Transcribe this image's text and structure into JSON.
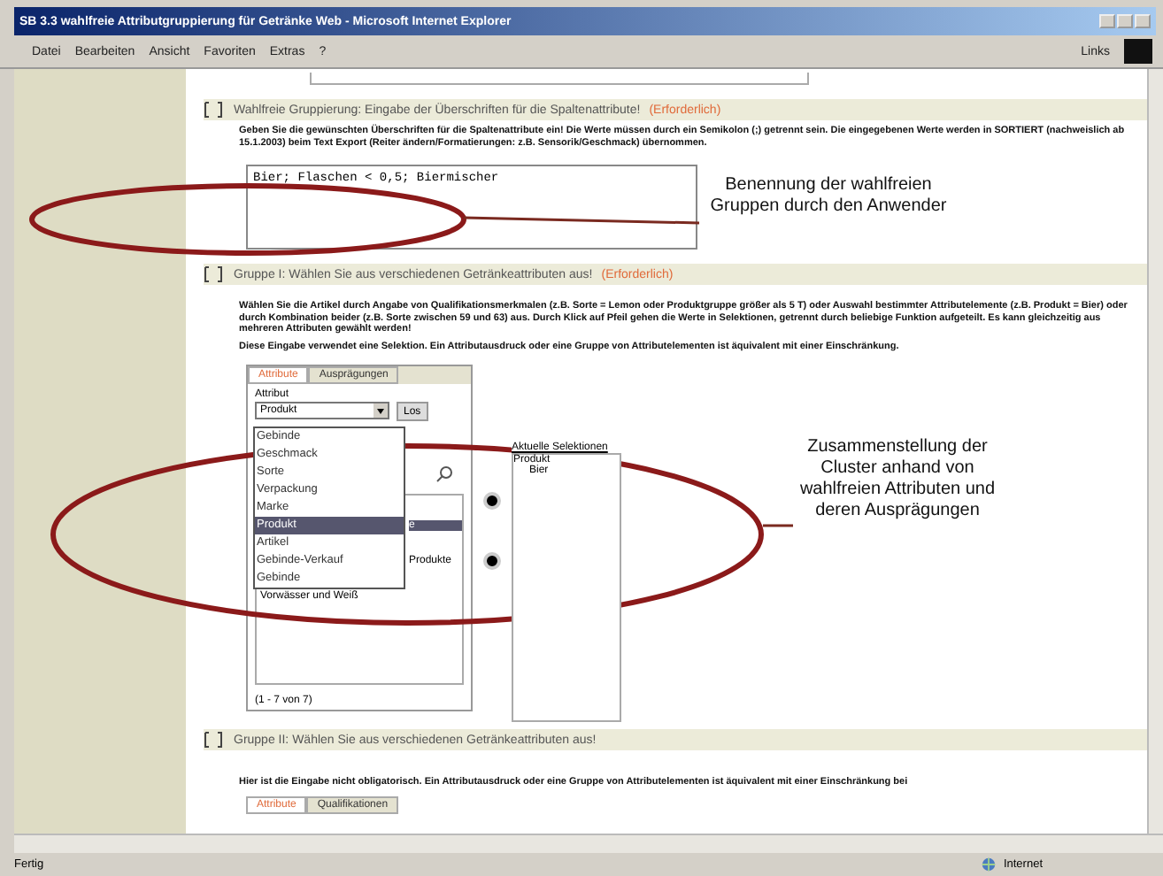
{
  "window": {
    "title": "SB 3.3 wahlfreie Attributgruppierung für Getränke Web - Microsoft Internet Explorer"
  },
  "menu": [
    "Datei",
    "Bearbeiten",
    "Ansicht",
    "Favoriten",
    "Extras",
    "?"
  ],
  "links_label": "Links",
  "sections": [
    {
      "kind": "names",
      "title": "Wahlfreie Gruppierung: Eingabe der Überschriften für die Spaltenattribute!",
      "required": "(Erforderlich)",
      "text": "Geben Sie die gewünschten Überschriften für die Spaltenattribute ein! Die Werte müssen durch ein Semikolon (;) getrennt sein. Die eingegebenen Werte werden in SORTIERT (nachweislich ab 15.1.2003) beim Text Export (Reiter ändern/Formatierungen: z.B. Sensorik/Geschmack) übernommen.",
      "value": "Bier; Flaschen < 0,5; Biermischer"
    },
    {
      "kind": "group",
      "title": "Gruppe I: Wählen Sie aus verschiedenen Getränkeattributen aus!",
      "required": "(Erforderlich)",
      "text": "Wählen Sie die Artikel durch Angabe von Qualifikationsmerkmalen (z.B. Sorte = Lemon oder Produktgruppe größer als 5 T) oder Auswahl bestimmter Attributelemente (z.B. Produkt = Bier) oder durch Kombination beider (z.B. Sorte zwischen 59 und 63) aus. Durch Klick auf Pfeil gehen die Werte in Selektionen, getrennt durch beliebige Funktion aufgeteilt. Es kann gleichzeitig aus mehreren Attributen gewählt werden!",
      "text2": "Diese Eingabe verwendet eine Selektion. Ein Attributausdruck oder eine Gruppe von Attributelementen ist äquivalent mit einer Einschränkung.",
      "tabs": [
        {
          "label": "Attribute",
          "selected": true
        },
        {
          "label": "Ausprägungen",
          "selected": false
        }
      ],
      "field_label": "Attribut",
      "select_value": "Produkt",
      "go_button": "Los",
      "options": [
        {
          "label": "Gebinde",
          "selected": false
        },
        {
          "label": "Geschmack",
          "selected": false
        },
        {
          "label": "Sorte",
          "selected": false
        },
        {
          "label": "Verpackung",
          "selected": false
        },
        {
          "label": "Marke",
          "selected": false
        },
        {
          "label": "Produkt",
          "selected": true
        },
        {
          "label": "Artikel",
          "selected": false
        },
        {
          "label": "Gebinde-Verkauf",
          "selected": false
        },
        {
          "label": "Gebinde",
          "selected": false
        }
      ],
      "behind_items": [
        {
          "label": "e",
          "selected": true
        },
        {
          "label": "Produkte",
          "selected": false
        },
        {
          "label": "Vorwässer und Weiß",
          "selected": false
        }
      ],
      "pager": "(1 - 7 von 7)",
      "selection_title": "Aktuelle Selektionen",
      "selection": [
        {
          "label": "Produkt",
          "children": [
            {
              "label": "Bier"
            }
          ]
        }
      ]
    },
    {
      "kind": "group_optional",
      "title": "Gruppe II: Wählen Sie aus verschiedenen Getränkeattributen aus!",
      "text": "Hier ist die Eingabe nicht obligatorisch. Ein Attributausdruck oder eine Gruppe von Attributelementen ist äquivalent mit einer Einschränkung bei",
      "tabs": [
        {
          "label": "Attribute",
          "selected": true
        },
        {
          "label": "Qualifikationen",
          "selected": false
        }
      ]
    }
  ],
  "annotations": [
    "Benennung der wahlfreien Gruppen durch den Anwender",
    "Zusammenstellung der Cluster anhand von wahlfreien Attributen und deren Ausprägungen"
  ],
  "status_bar": {
    "text": "Fertig",
    "zone": "Internet"
  }
}
